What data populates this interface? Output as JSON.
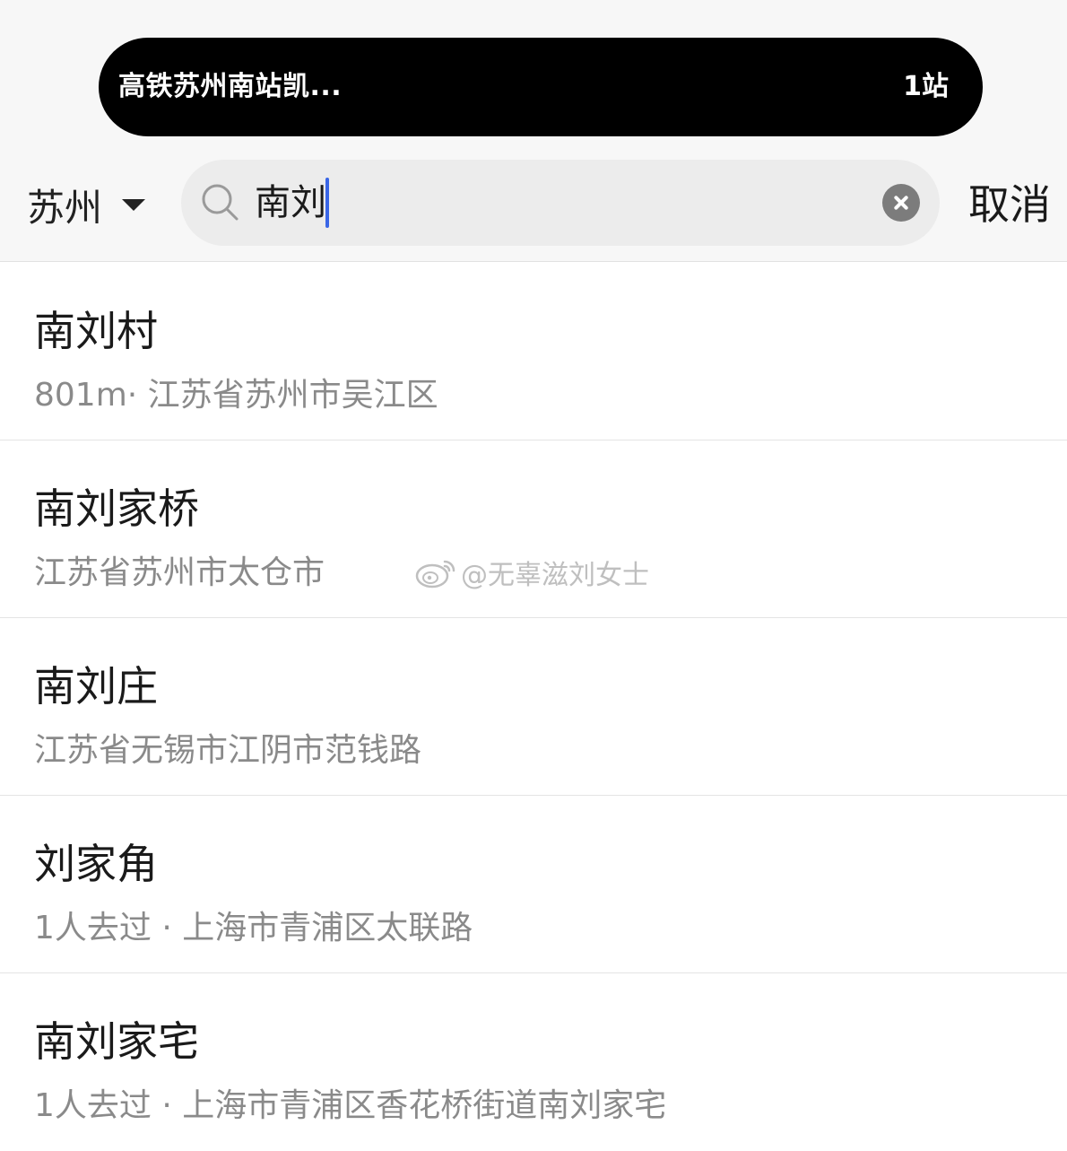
{
  "status_island": {
    "title": "高铁苏州南站凯...",
    "right_text": "1站"
  },
  "header": {
    "city_label": "苏州",
    "search_value": "南刘",
    "cancel_label": "取消"
  },
  "results": [
    {
      "title": "南刘村",
      "subtitle": "801m· 江苏省苏州市吴江区"
    },
    {
      "title": "南刘家桥",
      "subtitle": "江苏省苏州市太仓市"
    },
    {
      "title": "南刘庄",
      "subtitle": "江苏省无锡市江阴市范钱路"
    },
    {
      "title": "刘家角",
      "subtitle": "1人去过 · 上海市青浦区太联路"
    },
    {
      "title": "南刘家宅",
      "subtitle": "1人去过 · 上海市青浦区香花桥街道南刘家宅"
    }
  ],
  "watermark": {
    "text": "@无辜滋刘女士"
  },
  "icons": {
    "search": "search-icon",
    "clear": "clear-icon",
    "dropdown": "caret-down-icon",
    "watermark_logo": "weibo-logo-icon"
  },
  "colors": {
    "caret": "#3a66e6",
    "island_bg": "#000000"
  }
}
